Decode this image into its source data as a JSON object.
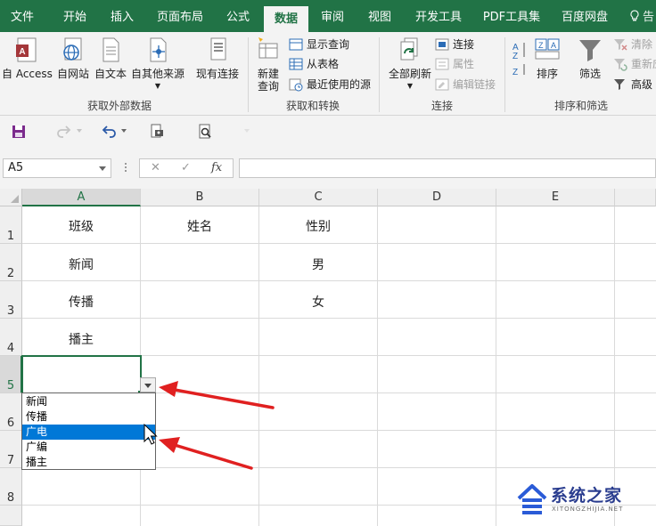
{
  "tabs": [
    "文件",
    "开始",
    "插入",
    "页面布局",
    "公式",
    "数据",
    "审阅",
    "视图",
    "开发工具",
    "PDF工具集",
    "百度网盘"
  ],
  "active_tab": "数据",
  "tell_me": "告",
  "ribbon": {
    "get_external": {
      "label": "获取外部数据",
      "access": "自 Access",
      "web": "自网站",
      "text": "自文本",
      "other": "自其他来源",
      "existing": "现有连接"
    },
    "get_transform": {
      "label": "获取和转换",
      "new_query_line1": "新建",
      "new_query_line2": "查询",
      "show_queries": "显示查询",
      "from_table": "从表格",
      "recent_sources": "最近使用的源"
    },
    "connections": {
      "label": "连接",
      "refresh_all": "全部刷新",
      "connections": "连接",
      "properties": "属性",
      "edit_links": "编辑链接"
    },
    "sort_filter": {
      "label": "排序和筛选",
      "sort": "排序",
      "filter": "筛选",
      "clear": "清除",
      "reapply": "重新应",
      "advanced": "高级"
    }
  },
  "name_box": "A5",
  "formula": {
    "cancel": "✕",
    "enter": "✓",
    "fx": "fx",
    "value": ""
  },
  "columns": [
    "A",
    "B",
    "C",
    "D",
    "E"
  ],
  "rows": [
    "1",
    "2",
    "3",
    "4",
    "5",
    "6",
    "7",
    "8"
  ],
  "cells": {
    "a1": "班级",
    "b1": "姓名",
    "c1": "性别",
    "a2": "新闻",
    "c2": "男",
    "a3": "传播",
    "c3": "女",
    "a4": "播主"
  },
  "dropdown_items": [
    "新闻",
    "传播",
    "广电",
    "广编",
    "播主"
  ],
  "dropdown_highlight": "广电",
  "watermark": {
    "title": "系统之家",
    "url": "XITONGZHIJIA.NET"
  },
  "colors": {
    "excel_green": "#217346",
    "arrow_red": "#e02020",
    "highlight_blue": "#0078d7"
  }
}
